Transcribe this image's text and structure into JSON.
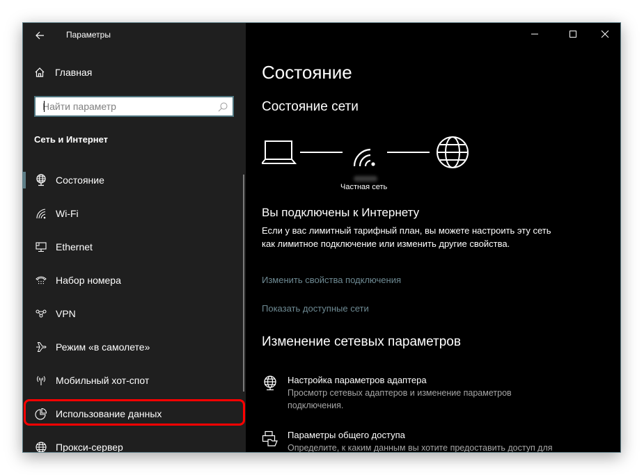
{
  "window": {
    "app_title": "Параметры",
    "controls": {
      "minimize": "minimize-icon",
      "maximize": "maximize-icon",
      "close": "close-icon"
    }
  },
  "sidebar": {
    "back_icon": "arrow-left-icon",
    "home_label": "Главная",
    "home_icon": "home-icon",
    "search": {
      "placeholder": "Найти параметр",
      "value": "",
      "icon": "search-icon"
    },
    "section_title": "Сеть и Интернет",
    "items": [
      {
        "label": "Состояние",
        "icon": "network-status-icon",
        "active": true
      },
      {
        "label": "Wi-Fi",
        "icon": "wifi-icon",
        "active": false
      },
      {
        "label": "Ethernet",
        "icon": "ethernet-icon",
        "active": false
      },
      {
        "label": "Набор номера",
        "icon": "dialup-phone-icon",
        "active": false
      },
      {
        "label": "VPN",
        "icon": "vpn-icon",
        "active": false
      },
      {
        "label": "Режим «в самолете»",
        "icon": "airplane-icon",
        "active": false
      },
      {
        "label": "Мобильный хот-спот",
        "icon": "hotspot-icon",
        "active": false
      },
      {
        "label": "Использование данных",
        "icon": "data-usage-icon",
        "active": false,
        "highlighted": true
      },
      {
        "label": "Прокси-сервер",
        "icon": "globe-icon",
        "active": false
      }
    ],
    "accent_color": "#5f7f88",
    "highlight_color": "#ff0000"
  },
  "main": {
    "page_title": "Состояние",
    "network_status_heading": "Состояние сети",
    "diagram": {
      "nodes": [
        "laptop-icon",
        "wifi-signal-icon",
        "globe-icon"
      ],
      "network_type": "Частная сеть"
    },
    "connected_title": "Вы подключены к Интернету",
    "connected_description": "Если у вас лимитный тарифный план, вы можете настроить эту сеть как лимитное подключение или изменить другие свойства.",
    "links": {
      "change_properties": "Изменить свойства подключения",
      "show_networks": "Показать доступные сети"
    },
    "link_color": "#6e8a93",
    "change_settings_heading": "Изменение сетевых параметров",
    "settings": [
      {
        "title": "Настройка параметров адаптера",
        "description": "Просмотр сетевых адаптеров и изменение параметров подключения.",
        "icon": "adapter-globe-icon"
      },
      {
        "title": "Параметры общего доступа",
        "description": "Определите, к каким данным вы хотите предоставить доступ для",
        "icon": "sharing-printer-icon"
      }
    ]
  }
}
